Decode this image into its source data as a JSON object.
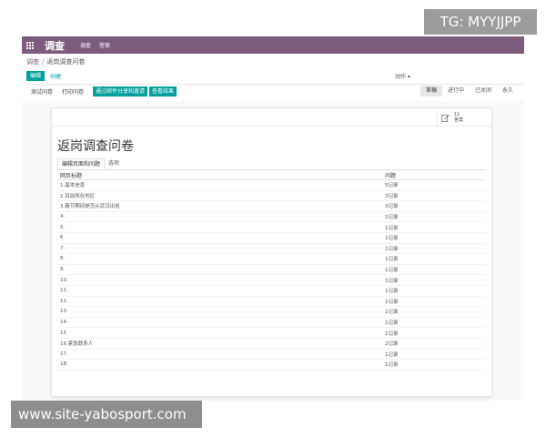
{
  "watermarks": {
    "top_right": "TG: MYYJJPP",
    "bottom_left": "www.site-yabosport.com"
  },
  "colors": {
    "topbar": "#7c5b7d",
    "accent": "#00a09d"
  },
  "topbar": {
    "apps_icon": "apps-grid-icon",
    "brand": "调查",
    "nav": [
      "调查",
      "答案"
    ]
  },
  "breadcrumb": {
    "parent": "调查",
    "separator": "/",
    "current": "返岗调查问卷"
  },
  "controls": {
    "edit": "编辑",
    "create": "创建",
    "action": "动作 ▾"
  },
  "statusbar": {
    "buttons": [
      "测试问卷",
      "打印问卷"
    ],
    "primary_buttons": [
      "通过邮件分享和邀请",
      "查看结果"
    ],
    "stages": [
      "草稿",
      "进行中",
      "已关闭",
      "永久"
    ],
    "active_stage": "草稿"
  },
  "stat_button": {
    "icon": "edit-icon",
    "count": "11",
    "label": "答案"
  },
  "form": {
    "title": "返岗调查问卷",
    "tabs": [
      "编辑页面和问题",
      "选项"
    ],
    "table": {
      "headers": [
        "网页标题",
        "问题"
      ],
      "rows": [
        [
          "1.基本信息",
          "5记录"
        ],
        [
          "2.目前所在地区",
          "3记录"
        ],
        [
          "3.春节期间是否从武汉出省",
          "3记录"
        ],
        [
          "4.",
          "1记录"
        ],
        [
          "5.",
          "1记录"
        ],
        [
          "6.",
          "1记录"
        ],
        [
          "7.",
          "1记录"
        ],
        [
          "8.",
          "1记录"
        ],
        [
          "9.",
          "1记录"
        ],
        [
          "10.",
          "1记录"
        ],
        [
          "11.",
          "1记录"
        ],
        [
          "12.",
          "1记录"
        ],
        [
          "13.",
          "1记录"
        ],
        [
          "14.",
          "1记录"
        ],
        [
          "15",
          "1记录"
        ],
        [
          "16.紧急联系人",
          "2记录"
        ],
        [
          "17.",
          "1记录"
        ],
        [
          "18.",
          "1记录"
        ]
      ]
    }
  }
}
